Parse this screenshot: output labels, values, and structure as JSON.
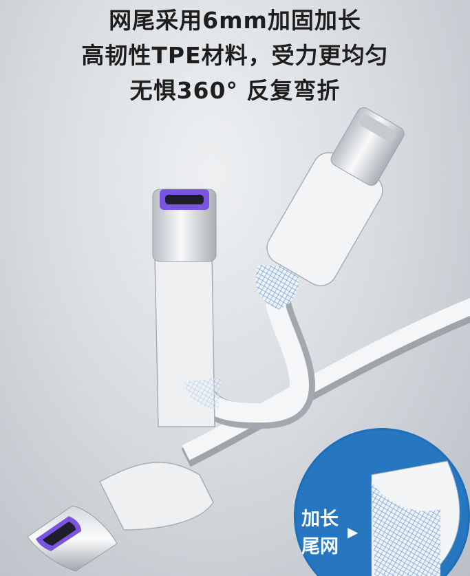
{
  "headline": {
    "line1": "网尾采用6mm加固加长",
    "line2": "高韧性TPE材料，受力更均匀",
    "line3": "无惧360° 反复弯折"
  },
  "callout": {
    "line1": "加长",
    "line2": "尾网",
    "arrow_icon": "triangle-right-icon"
  },
  "colors": {
    "background": "#d9dde1",
    "cable": "#f4f6f8",
    "connector_accent": "#7b55e0",
    "mesh": "#5f8fcf",
    "callout_circle": "#1d6fb8",
    "headline_text": "#1e1e1e"
  }
}
